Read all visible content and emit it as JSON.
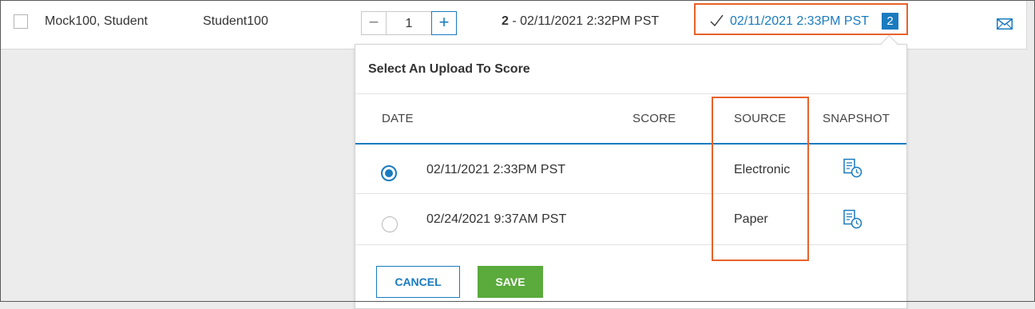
{
  "row": {
    "student_name": "Mock100, Student",
    "student_id": "Student100",
    "stepper": {
      "minus": "−",
      "value": "1",
      "plus": "+"
    },
    "attempt_number": "2",
    "attempt_separator": " - ",
    "attempt_timestamp": "02/11/2021 2:32PM PST",
    "upload_link": "02/11/2021 2:33PM PST",
    "upload_count": "2"
  },
  "popover": {
    "title": "Select An Upload To Score",
    "columns": [
      "DATE",
      "SCORE",
      "SOURCE",
      "SNAPSHOT"
    ],
    "rows": [
      {
        "date": "02/11/2021 2:33PM PST",
        "score": "",
        "source": "Electronic",
        "selected": true
      },
      {
        "date": "02/24/2021 9:37AM PST",
        "score": "",
        "source": "Paper",
        "selected": false
      }
    ],
    "cancel_label": "CANCEL",
    "save_label": "SAVE"
  },
  "colors": {
    "accent": "#1a7bbf",
    "highlight": "#e8622a",
    "save": "#5aaa3c"
  },
  "icons": {
    "check": "check-icon",
    "mail": "mail-icon",
    "snapshot": "snapshot-icon"
  }
}
